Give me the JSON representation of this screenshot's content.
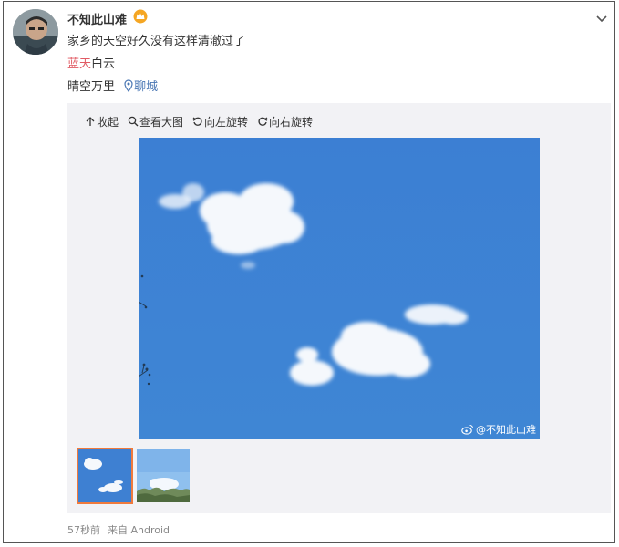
{
  "post": {
    "username": "不知此山难",
    "text": "家乡的天空好久没有这样清澈过了",
    "topic_highlight": "蓝天",
    "topic_rest": "白云",
    "line3": "晴空万里",
    "location": "聊城"
  },
  "toolbar": {
    "collapse": "收起",
    "view_large": "查看大图",
    "rotate_left": "向左旋转",
    "rotate_right": "向右旋转"
  },
  "photo": {
    "watermark": "@不知此山难"
  },
  "footer": {
    "time": "57秒前",
    "source": "来自 Android"
  },
  "colors": {
    "topic": "#e15b64",
    "location": "#4a77b4",
    "sky": "#3a7fd0",
    "thumb_selected_border": "#f07a3c"
  }
}
